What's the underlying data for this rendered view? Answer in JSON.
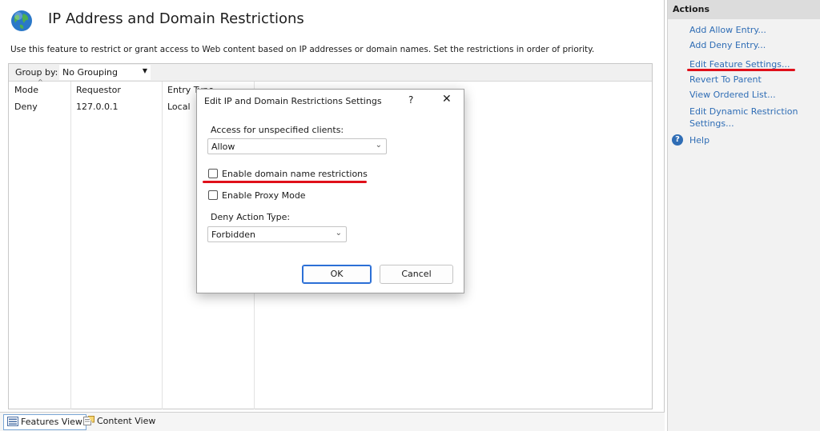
{
  "page": {
    "title": "IP Address and Domain Restrictions",
    "description": "Use this feature to restrict or grant access to Web content based on IP addresses or domain names. Set the restrictions in order of priority."
  },
  "group_by": {
    "label": "Group by:",
    "value": "No Grouping"
  },
  "table": {
    "columns": [
      "Mode",
      "Requestor",
      "Entry Type"
    ],
    "rows": [
      {
        "mode": "Deny",
        "requestor": "127.0.0.1",
        "entry_type": "Local"
      }
    ]
  },
  "views": {
    "features": "Features View",
    "content": "Content View"
  },
  "actions": {
    "header": "Actions",
    "items": [
      "Add Allow Entry...",
      "Add Deny Entry...",
      "Edit Feature Settings...",
      "Revert To Parent",
      "View Ordered List...",
      "Edit Dynamic Restriction",
      "Settings...",
      "Help"
    ]
  },
  "dialog": {
    "title": "Edit IP and Domain Restrictions Settings",
    "help_glyph": "?",
    "close_glyph": "✕",
    "access_label": "Access for unspecified clients:",
    "access_value": "Allow",
    "enable_domain_label": "Enable domain name restrictions",
    "enable_domain_checked": false,
    "enable_proxy_label": "Enable Proxy Mode",
    "enable_proxy_checked": false,
    "deny_action_label": "Deny Action Type:",
    "deny_action_value": "Forbidden",
    "ok_label": "OK",
    "cancel_label": "Cancel"
  },
  "colors": {
    "link": "#2f6db5",
    "highlight_underline": "#e0101a",
    "default_button_border": "#2b6fd6"
  },
  "icons": {
    "app": "globe-icon",
    "help": "help-icon",
    "features_view": "features-view-icon",
    "content_view": "content-view-icon"
  }
}
